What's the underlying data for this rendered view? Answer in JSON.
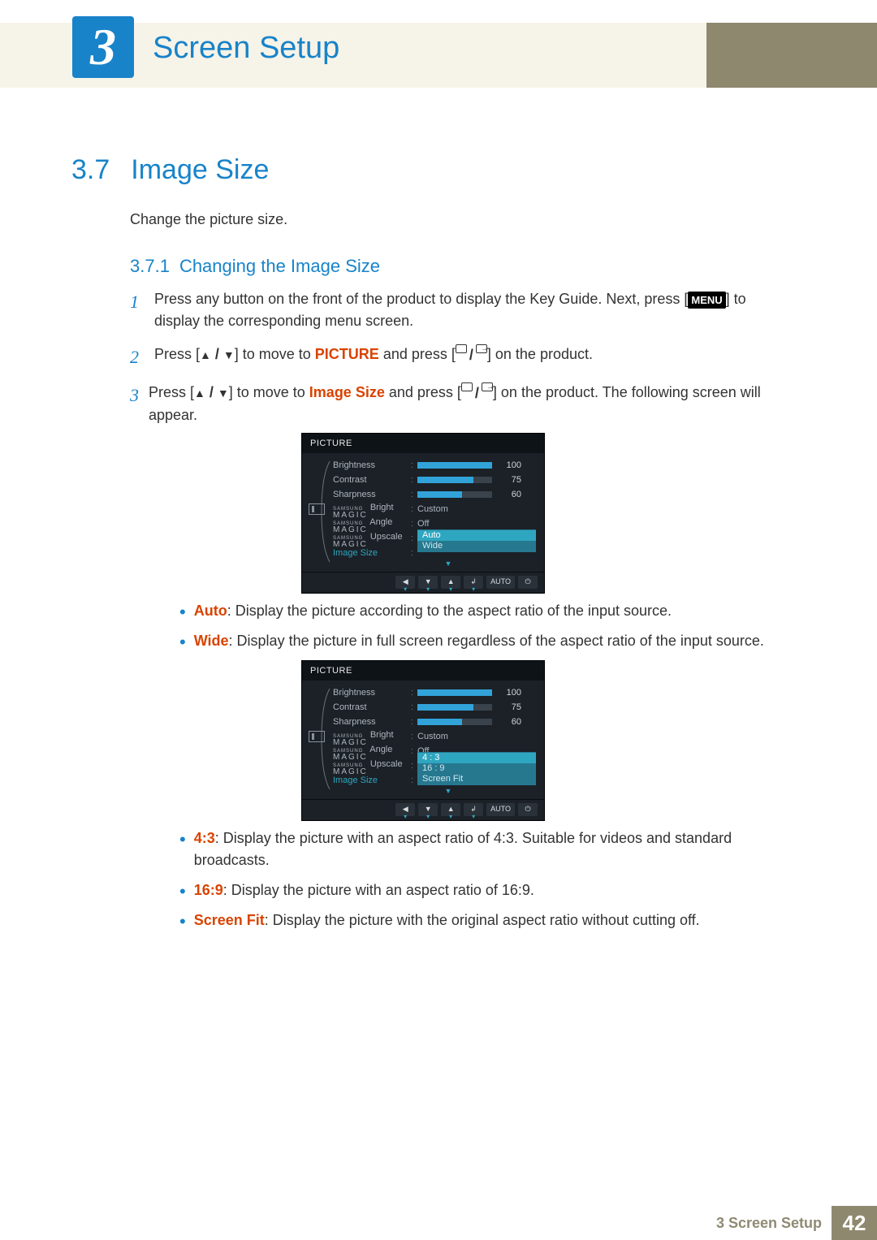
{
  "chapter": {
    "num": "3",
    "title": "Screen Setup"
  },
  "section": {
    "num": "3.7",
    "title": "Image Size"
  },
  "intro": "Change the picture size.",
  "subsection": {
    "num": "3.7.1",
    "title": "Changing the Image Size"
  },
  "steps": {
    "s1_a": "Press any button on the front of the product to display the Key Guide. Next, press [",
    "s1_menu": "MENU",
    "s1_b": "] to display the corresponding menu screen.",
    "s2_a": "Press [",
    "s2_b": "] to move to ",
    "s2_target": "PICTURE",
    "s2_c": " and press [",
    "s2_d": "] on the product.",
    "s3_a": "Press [",
    "s3_b": "] to move to ",
    "s3_target": "Image Size",
    "s3_c": " and press [",
    "s3_d": "] on the product. The following screen will appear."
  },
  "osd": {
    "title": "PICTURE",
    "brightness": {
      "label": "Brightness",
      "val": "100",
      "pct": 100
    },
    "contrast": {
      "label": "Contrast",
      "val": "75",
      "pct": 75
    },
    "sharpness": {
      "label": "Sharpness",
      "val": "60",
      "pct": 60
    },
    "magic_bright": {
      "label": "Bright",
      "val": "Custom"
    },
    "magic_angle": {
      "label": "Angle",
      "val": "Off"
    },
    "magic_upscale": {
      "label": "Upscale"
    },
    "image_size": {
      "label": "Image Size"
    },
    "picks1": [
      "Auto",
      "Wide"
    ],
    "picks2": [
      "4 : 3",
      "16 : 9",
      "Screen Fit"
    ],
    "footer_auto": "AUTO"
  },
  "bullets1": {
    "auto_l": "Auto",
    "auto_t": ": Display the picture according to the aspect ratio of the input source.",
    "wide_l": "Wide",
    "wide_t": ": Display the picture in full screen regardless of the aspect ratio of the input source."
  },
  "bullets2": {
    "b43_l": "4:3",
    "b43_t": ": Display the picture with an aspect ratio of 4:3. Suitable for videos and standard broadcasts.",
    "b169_l": "16:9",
    "b169_t": ": Display the picture with an aspect ratio of 16:9.",
    "fit_l": "Screen Fit",
    "fit_t": ": Display the picture with the original aspect ratio without cutting off."
  },
  "footer": {
    "text": "3 Screen Setup",
    "page": "42"
  }
}
